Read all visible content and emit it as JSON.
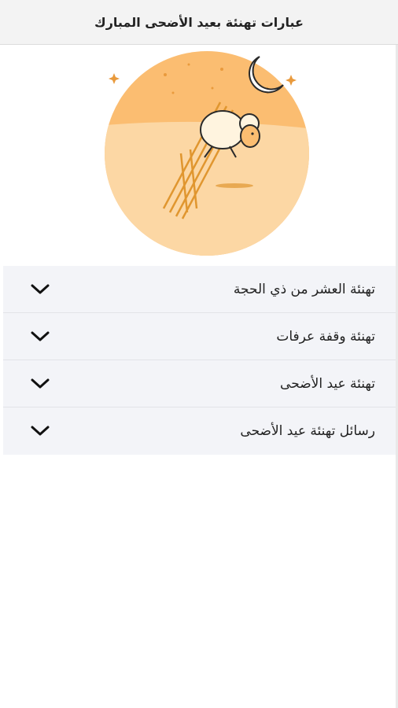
{
  "header": {
    "title": "عبارات تهنئة بعيد الأضحى المبارك"
  },
  "colors": {
    "circle_top": "#fbbd71",
    "circle_bottom": "#fcd7a4",
    "accent": "#e99a3c"
  },
  "hero": {
    "icon": "sheep-jumping-fence-illustration"
  },
  "accordion": {
    "items": [
      {
        "label": "تهنئة العشر من ذي الحجة",
        "icon": "chevron-down-icon"
      },
      {
        "label": "تهنئة وقفة عرفات",
        "icon": "chevron-down-icon"
      },
      {
        "label": "تهنئة عيد الأضحى",
        "icon": "chevron-down-icon"
      },
      {
        "label": "رسائل تهنئة عيد الأضحى",
        "icon": "chevron-down-icon"
      }
    ]
  }
}
